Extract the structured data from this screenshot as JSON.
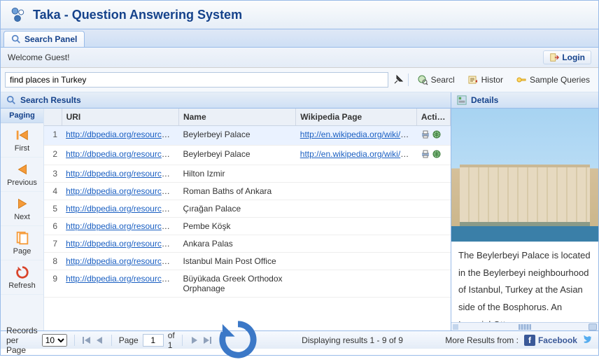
{
  "app": {
    "title": "Taka - Question Answering System"
  },
  "tabs": {
    "search_panel": "Search Panel"
  },
  "welcome": {
    "text": "Welcome Guest!",
    "login": "Login"
  },
  "query": {
    "value": "find places in Turkey",
    "search_btn": "Searcl",
    "history_btn": "Histor",
    "samples_btn": "Sample Queries"
  },
  "results": {
    "title": "Search Results",
    "columns": {
      "idx": "",
      "uri": "URI",
      "name": "Name",
      "wiki": "Wikipedia Page",
      "action": "Action"
    },
    "rows": [
      {
        "idx": 1,
        "uri": "http://dbpedia.org/resource/B...",
        "name": "Beylerbeyi Palace",
        "wiki": "http://en.wikipedia.org/wiki/B...",
        "selected": true,
        "actions": true
      },
      {
        "idx": 2,
        "uri": "http://dbpedia.org/resource/B...",
        "name": "Beylerbeyi Palace",
        "wiki": "http://en.wikipedia.org/wiki/B...",
        "actions": true
      },
      {
        "idx": 3,
        "uri": "http://dbpedia.org/resource/...",
        "name": "Hilton Izmir",
        "wiki": ""
      },
      {
        "idx": 4,
        "uri": "http://dbpedia.org/resource/...",
        "name": "Roman Baths of Ankara",
        "wiki": ""
      },
      {
        "idx": 5,
        "uri": "http://dbpedia.org/resource/...",
        "name": "Çırağan Palace",
        "wiki": ""
      },
      {
        "idx": 6,
        "uri": "http://dbpedia.org/resource/P...",
        "name": "Pembe Köşk",
        "wiki": ""
      },
      {
        "idx": 7,
        "uri": "http://dbpedia.org/resource/A...",
        "name": "Ankara Palas",
        "wiki": ""
      },
      {
        "idx": 8,
        "uri": "http://dbpedia.org/resource/I...",
        "name": "Istanbul Main Post Office",
        "wiki": ""
      },
      {
        "idx": 9,
        "uri": "http://dbpedia.org/resource/B...",
        "name": "Büyükada Greek Orthodox Orphanage",
        "wiki": "",
        "wrap": true
      }
    ]
  },
  "paging": {
    "title": "Paging",
    "first": "First",
    "previous": "Previous",
    "next": "Next",
    "page": "Page",
    "refresh": "Refresh"
  },
  "details": {
    "title": "Details",
    "text": "The Beylerbeyi Palace is located in the Beylerbeyi neighbourhood of Istanbul, Turkey at the Asian side of the Bosphorus. An Imperial Ottoman summer"
  },
  "footer": {
    "records_per_page_label": "Records per Page",
    "records_per_page_value": "10",
    "page_label": "Page",
    "page_value": "1",
    "of_label": "of 1",
    "displaying": "Displaying results 1 - 9 of 9",
    "more_results": "More Results from :",
    "facebook": "Facebook"
  }
}
